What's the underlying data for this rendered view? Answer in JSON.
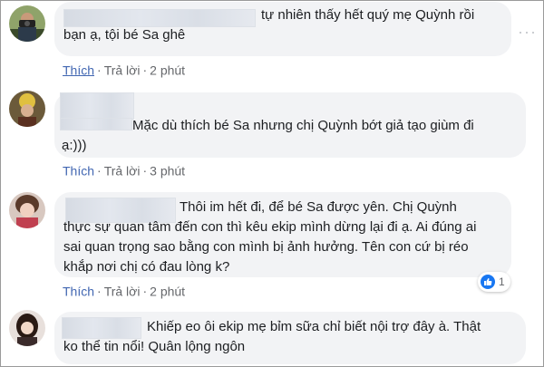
{
  "comments": [
    {
      "text": "tự nhiên thấy hết quý mẹ Quỳnh rồi\nbạn ạ, tội bé Sa ghê",
      "like_label": "Thích",
      "reply_label": "Trả lời",
      "time": "2 phút",
      "more_icon": "ellipsis-icon"
    },
    {
      "text": "Mặc dù thích bé Sa nhưng chị Quỳnh bớt giả tạo giùm đi\nạ:)))",
      "like_label": "Thích",
      "reply_label": "Trả lời",
      "time": "3 phút"
    },
    {
      "text": "Thôi im hết đi, để bé Sa được yên. Chị Quỳnh\nthực sự quan tâm đến con thì kêu ekip mình dừng lại đi ạ. Ai đúng ai\nsai quan trọng sao bằng con mình bị ảnh hưởng. Tên con cứ bị réo\nkhắp nơi chị có đau lòng k?",
      "like_label": "Thích",
      "reply_label": "Trả lời",
      "time": "2 phút",
      "reaction_icon": "like-reaction-icon",
      "reaction_count": "1"
    },
    {
      "text": "Khiếp eo ôi ekip mẹ bỉm sữa chỉ biết nội trợ đây à. Thật\nko thể tin nổi! Quân lộng ngôn"
    }
  ],
  "colors": {
    "bubble": "#f2f3f5",
    "like_link": "#4267b2",
    "meta": "#65676b",
    "reaction_blue": "#1877f2"
  }
}
